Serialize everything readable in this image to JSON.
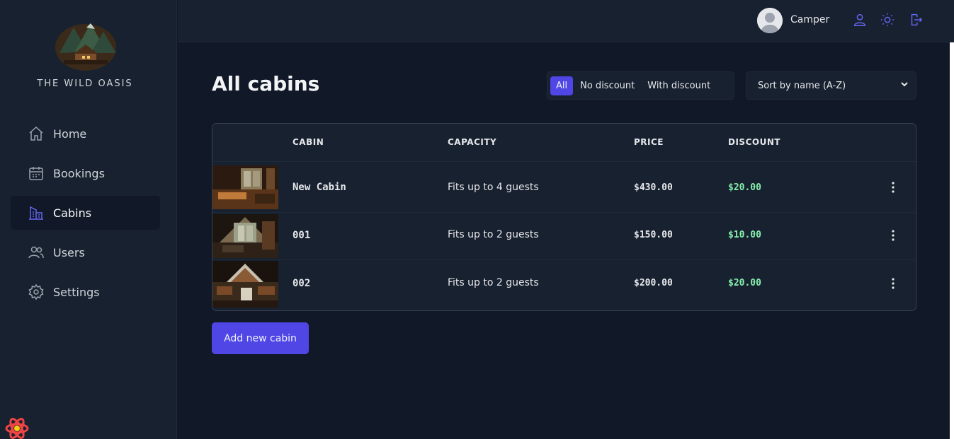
{
  "brand": {
    "name": "THE WILD OASIS"
  },
  "sidebar": {
    "items": [
      {
        "label": "Home",
        "icon": "home-icon",
        "active": false
      },
      {
        "label": "Bookings",
        "icon": "calendar-icon",
        "active": false
      },
      {
        "label": "Cabins",
        "icon": "building-icon",
        "active": true
      },
      {
        "label": "Users",
        "icon": "users-icon",
        "active": false
      },
      {
        "label": "Settings",
        "icon": "gear-icon",
        "active": false
      }
    ]
  },
  "header": {
    "user_name": "Camper",
    "icons": [
      "user-icon",
      "sun-icon",
      "logout-icon"
    ]
  },
  "main": {
    "title": "All cabins",
    "filter": {
      "options": [
        "All",
        "No discount",
        "With discount"
      ],
      "selected": "All"
    },
    "sort": {
      "selected": "Sort by name (A-Z)"
    },
    "table": {
      "columns": [
        "",
        "CABIN",
        "CAPACITY",
        "PRICE",
        "DISCOUNT"
      ],
      "rows": [
        {
          "name": "New Cabin",
          "capacity": "Fits up to 4 guests",
          "price": "$430.00",
          "discount": "$20.00"
        },
        {
          "name": "001",
          "capacity": "Fits up to 2 guests",
          "price": "$150.00",
          "discount": "$10.00"
        },
        {
          "name": "002",
          "capacity": "Fits up to 2 guests",
          "price": "$200.00",
          "discount": "$20.00"
        }
      ]
    },
    "add_button": "Add new cabin"
  },
  "colors": {
    "accent": "#4f46e5",
    "background": "#111827",
    "panel": "#18212f",
    "discount": "#86efac"
  }
}
